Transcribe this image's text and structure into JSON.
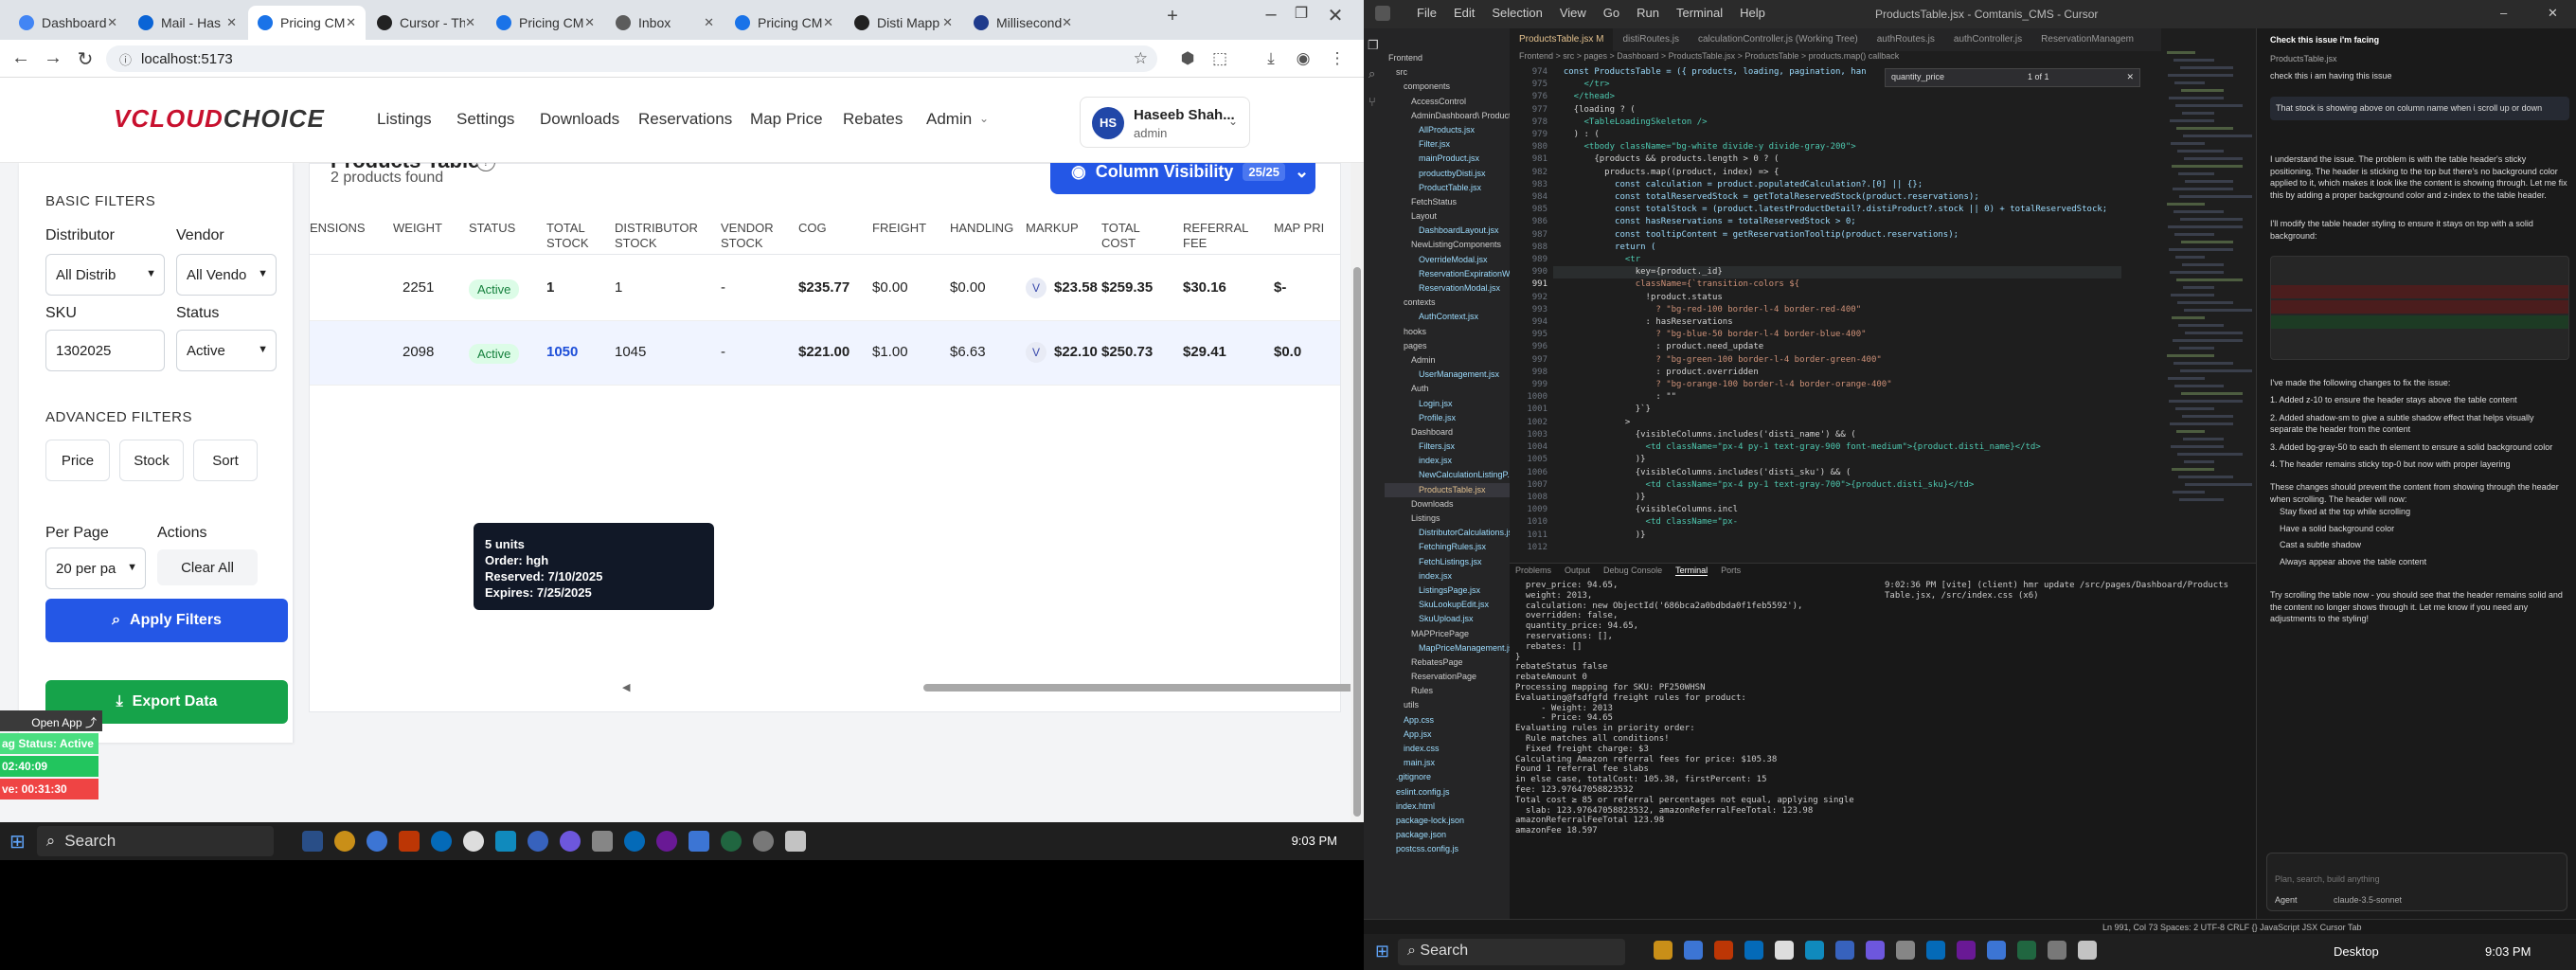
{
  "browser": {
    "tabs": [
      {
        "label": "Dashboard",
        "color": "#4285f4"
      },
      {
        "label": "Mail - Has",
        "color": "#0a64d6"
      },
      {
        "label": "Pricing CM",
        "color": "#1a73e8"
      },
      {
        "label": "Cursor - Th",
        "color": "#222222"
      },
      {
        "label": "Pricing CM",
        "color": "#1a73e8"
      },
      {
        "label": "Inbox",
        "color": "#5c5c5c"
      },
      {
        "label": "Pricing CM",
        "color": "#1a73e8"
      },
      {
        "label": "Disti Mapp",
        "color": "#222222"
      },
      {
        "label": "Millisecond",
        "color": "#1f3b8c"
      }
    ],
    "url": "localhost:5173"
  },
  "app": {
    "logo_text": "VCLOUD",
    "logo_text2": "CHOICE",
    "nav": [
      "Listings",
      "Settings",
      "Downloads",
      "Reservations",
      "Map Price",
      "Rebates",
      "Admin"
    ],
    "user_initials": "HS",
    "user_name": "Haseeb Shah...",
    "user_role": "admin"
  },
  "filters": {
    "basic_title": "BASIC FILTERS",
    "distributor_label": "Distributor",
    "distributor_value": "All Distrib",
    "vendor_label": "Vendor",
    "vendor_value": "All Vendo",
    "sku_label": "SKU",
    "sku_value": "1302025",
    "status_label": "Status",
    "status_value": "Active",
    "advanced_title": "ADVANCED FILTERS",
    "price_label": "Price",
    "stock_label": "Stock",
    "sort_label": "Sort",
    "per_page_label": "Per Page",
    "per_page_value": "20 per pa",
    "actions_label": "Actions",
    "clear_label": "Clear All",
    "apply_label": "Apply Filters",
    "export_label": "Export Data"
  },
  "table": {
    "title": "Products Table",
    "found": "2 products found",
    "colvis_label": "Column Visibility",
    "colvis_count": "25/25",
    "columns": [
      "ENSIONS",
      "WEIGHT",
      "STATUS",
      "TOTAL STOCK",
      "DISTRIBUTOR STOCK",
      "VENDOR STOCK",
      "COG",
      "FREIGHT",
      "HANDLING",
      "MARKUP",
      "TOTAL COST",
      "REFERRAL FEE",
      "MAP PRI"
    ],
    "rows": [
      {
        "weight": "2251",
        "status": "Active",
        "total_stock": "1",
        "dist_stock": "1",
        "vendor_stock": "-",
        "cog": "$235.77",
        "freight": "$0.00",
        "handling": "$0.00",
        "markup_badge": "V",
        "markup": "$23.58",
        "total_cost": "$259.35",
        "referral": "$30.16",
        "map": "$-"
      },
      {
        "weight": "2098",
        "status": "Active",
        "total_stock": "1050",
        "dist_stock": "1045",
        "vendor_stock": "-",
        "cog": "$221.00",
        "freight": "$1.00",
        "handling": "$6.63",
        "markup_badge": "V",
        "markup": "$22.10",
        "total_cost": "$250.73",
        "referral": "$29.41",
        "map": "$0.0"
      }
    ],
    "tooltip": [
      "5 units",
      "Order: hgh",
      "Reserved: 7/10/2025",
      "Expires: 7/25/2025"
    ]
  },
  "float_panel": {
    "open_app": "Open App",
    "status": "ag Status: Active",
    "time1": "02:40:09",
    "time2": "ve: 00:31:30"
  },
  "taskbar_left": {
    "search": "Search",
    "time": "9:03 PM"
  },
  "ide": {
    "menu": [
      "File",
      "Edit",
      "Selection",
      "View",
      "Go",
      "Run",
      "Terminal",
      "Help"
    ],
    "title": "ProductsTable.jsx - Comtanis_CMS - Cursor",
    "tabs": [
      "ProductsTable.jsx M",
      "distiRoutes.js",
      "calculationController.js (Working Tree)",
      "authRoutes.js",
      "authController.js",
      "ReservationManagem"
    ],
    "breadcrumb": "Frontend > src > pages > Dashboard > ProductsTable.jsx > ProductsTable > products.map() callback",
    "find_text": "quantity_price",
    "find_count": "1 of 1",
    "explorer": [
      "Frontend",
      "src",
      "components",
      "AccessControl",
      "AdminDashboard\\ Product",
      "AllProducts.jsx",
      "Filter.jsx",
      "mainProduct.jsx",
      "productbyDisti.jsx",
      "ProductTable.jsx",
      "FetchStatus",
      "Layout",
      "DashboardLayout.jsx",
      "NewListingComponents",
      "OverrideModal.jsx",
      "ReservationExpirationWarni...",
      "ReservationModal.jsx",
      "contexts",
      "AuthContext.jsx",
      "hooks",
      "pages",
      "Admin",
      "UserManagement.jsx",
      "Auth",
      "Login.jsx",
      "Profile.jsx",
      "Dashboard",
      "Filters.jsx",
      "index.jsx",
      "NewCalculationListingP...",
      "ProductsTable.jsx",
      "Downloads",
      "Listings",
      "DistributorCalculations.jsx",
      "FetchingRules.jsx",
      "FetchListings.jsx",
      "index.jsx",
      "ListingsPage.jsx",
      "SkuLookupEdit.jsx",
      "SkuUpload.jsx",
      "MAPPricePage",
      "MapPriceManagement.jsx",
      "RebatesPage",
      "ReservationPage",
      "Rules",
      "utils",
      "App.css",
      "App.jsx",
      "index.css",
      "main.jsx",
      ".gitignore",
      "eslint.config.js",
      "index.html",
      "package-lock.json",
      "package.json",
      "postcss.config.js"
    ],
    "line_numbers": [
      "974",
      "975",
      "976",
      "977",
      "978",
      "979",
      "980",
      "981",
      "982",
      "983",
      "984",
      "985",
      "986",
      "987",
      "988",
      "989",
      "990",
      "991",
      "992",
      "993",
      "994",
      "995",
      "996",
      "997",
      "998",
      "999",
      "1000",
      "1001",
      "1002",
      "1003",
      "1004",
      "1005",
      "1006",
      "1007",
      "1008",
      "1009",
      "1010",
      "1011",
      "1012"
    ],
    "code": [
      "  const ProductsTable = ({ products, loading, pagination, han",
      "      </tr>",
      "    </thead>",
      "    {loading ? (",
      "      <TableLoadingSkeleton />",
      "    ) : (",
      "      <tbody className=\"bg-white divide-y divide-gray-200\">",
      "        {products && products.length > 0 ? (",
      "          products.map((product, index) => {",
      "            const calculation = product.populatedCalculation?.[0] || {};",
      "            const totalReservedStock = getTotalReservedStock(product.reservations);",
      "            const totalStock = (product.latestProductDetail?.distiProduct?.stock || 0) + totalReservedStock;",
      "            const hasReservations = totalReservedStock > 0;",
      "            const tooltipContent = getReservationTooltip(product.reservations);",
      "",
      "            return (",
      "              <tr",
      "                key={product._id}",
      "                className={`transition-colors ${",
      "                  !product.status",
      "                    ? \"bg-red-100 border-l-4 border-red-400\"",
      "                  : hasReservations",
      "                    ? \"bg-blue-50 border-l-4 border-blue-400\"",
      "                    : product.need_update",
      "                    ? \"bg-green-100 border-l-4 border-green-400\"",
      "                    : product.overridden",
      "                    ? \"bg-orange-100 border-l-4 border-orange-400\"",
      "                    : \"\"",
      "                }`}",
      "              >",
      "                {visibleColumns.includes('disti_name') && (",
      "                  <td className=\"px-4 py-1 text-gray-900 font-medium\">{product.disti_name}</td>",
      "                )}",
      "                {visibleColumns.includes('disti_sku') && (",
      "                  <td className=\"px-4 py-1 text-gray-700\">{product.disti_sku}</td>",
      "                )}",
      "                {visibleColumns.incl",
      "                  <td className=\"px-",
      "                )}"
    ],
    "panel_tabs": [
      "Problems",
      "Output",
      "Debug Console",
      "Terminal",
      "Ports"
    ],
    "terminal": [
      "  prev_price: 94.65,",
      "  weight: 2013,",
      "  calculation: new ObjectId('686bca2a0bdbda0f1feb5592'),",
      "  overridden: false,",
      "  quantity_price: 94.65,",
      "  reservations: [],",
      "  rebates: []",
      "}",
      "rebateStatus false",
      "rebateAmount 0",
      "",
      "Processing mapping for SKU: PF250WHSN",
      "",
      "Evaluating@fsdfgfd freight rules for product:",
      "     - Weight: 2013",
      "     - Price: 94.65",
      "",
      "Evaluating rules in priority order:",
      "  Rule matches all conditions!",
      "  Fixed freight charge: $3",
      "",
      "Calculating Amazon referral fees for price: $105.38",
      "Found 1 referral fee slabs",
      "in else case, totalCost: 105.38, firstPercent: 15",
      "fee: 123.97647058823532",
      "Total cost ≥ 85 or referral percentages not equal, applying single",
      "  slab: 123.97647058823532, amazonReferralFeeTotal: 123.98",
      "amazonReferralFeeTotal 123.98",
      "amazonFee 18.597"
    ],
    "terminal2": [
      "9:02:36 PM [vite] (client) hmr update /src/pages/Dashboard/Products",
      "Table.jsx, /src/index.css (x6)"
    ],
    "chat": {
      "title": "Check this issue i'm facing",
      "context": "ProductsTable.jsx",
      "question": "check this i am having this issue",
      "user_msg": "That stock is showing above on column name when i scroll up or down",
      "reply1": "I understand the issue. The problem is with the table header's sticky positioning. The header is sticking to the top but there's no background color applied to it, which makes it look like the content is showing through. Let me fix this by adding a proper background color and z-index to the table header.",
      "reply2": "I'll modify the table header styling to ensure it stays on top with a solid background:",
      "changes_title": "I've made the following changes to fix the issue:",
      "changes": [
        "1. Added z-10 to ensure the header stays above the table content",
        "2. Added shadow-sm to give a subtle shadow effect that helps visually separate the header from the content",
        "3. Added bg-gray-50 to each th element to ensure a solid background color",
        "4. The header remains sticky top-0 but now with proper layering"
      ],
      "now_title": "These changes should prevent the content from showing through the header when scrolling. The header will now:",
      "bullets": [
        "Stay fixed at the top while scrolling",
        "Have a solid background color",
        "Cast a subtle shadow",
        "Always appear above the table content"
      ],
      "closing": "Try scrolling the table now - you should see that the header remains solid and the content no longer shows through it. Let me know if you need any adjustments to the styling!",
      "input_placeholder": "Plan, search, build anything",
      "agent_label": "Agent",
      "model_label": "claude-3.5-sonnet"
    },
    "statusbar": "Ln 991, Col 73   Spaces: 2   UTF-8   CRLF   {} JavaScript JSX   Cursor Tab",
    "taskbar_search": "Search",
    "taskbar_time": "9:03 PM",
    "desktop_label": "Desktop"
  }
}
